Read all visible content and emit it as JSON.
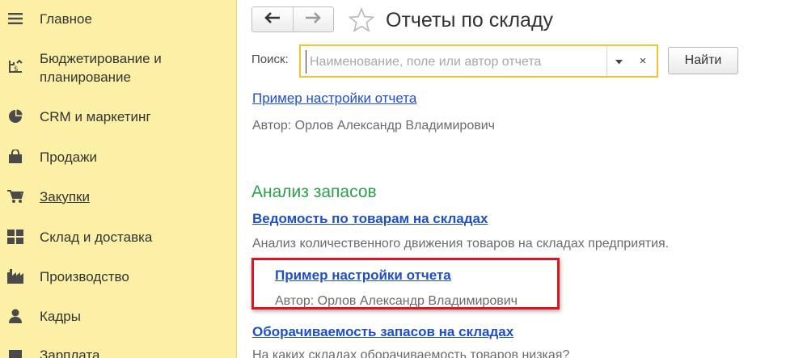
{
  "sidebar": {
    "items": [
      {
        "label": "Главное",
        "icon": "menu-lines-icon"
      },
      {
        "label": "Бюджетирование и",
        "label2": "планирование",
        "icon": "budget-icon"
      },
      {
        "label": "CRM и маркетинг",
        "icon": "pie-chart-icon"
      },
      {
        "label": "Продажи",
        "icon": "shopping-bag-icon"
      },
      {
        "label": "Закупки",
        "icon": "cart-icon"
      },
      {
        "label": "Склад и доставка",
        "icon": "warehouse-grid-icon"
      },
      {
        "label": "Производство",
        "icon": "factory-icon"
      },
      {
        "label": "Кадры",
        "icon": "person-icon"
      },
      {
        "label": "Зарплата",
        "icon": "salary-icon"
      }
    ]
  },
  "header": {
    "title": "Отчеты по складу"
  },
  "search": {
    "label": "Поиск:",
    "placeholder": "Наименование, поле или автор отчета",
    "value": "",
    "clear_symbol": "×",
    "find_label": "Найти"
  },
  "reports": {
    "top_link": "Пример настройки отчета",
    "top_desc": "Автор: Орлов Александр Владимирович",
    "section_title": "Анализ запасов",
    "items": [
      {
        "link": "Ведомость по товарам на складах",
        "desc": "Анализ количественного движения товаров на складах предприятия."
      },
      {
        "link": "Пример настройки отчета",
        "desc": "Автор: Орлов Александр Владимирович"
      },
      {
        "link": "Оборачиваемость запасов на складах",
        "desc": "На каких складах оборачиваемость товаров низкая?"
      }
    ]
  },
  "colors": {
    "sidebar_bg": "#fbf0a6",
    "link": "#1f4fc8",
    "section_title": "#2aa14a",
    "highlight_border": "#e0141e",
    "search_border": "#f0c431"
  }
}
